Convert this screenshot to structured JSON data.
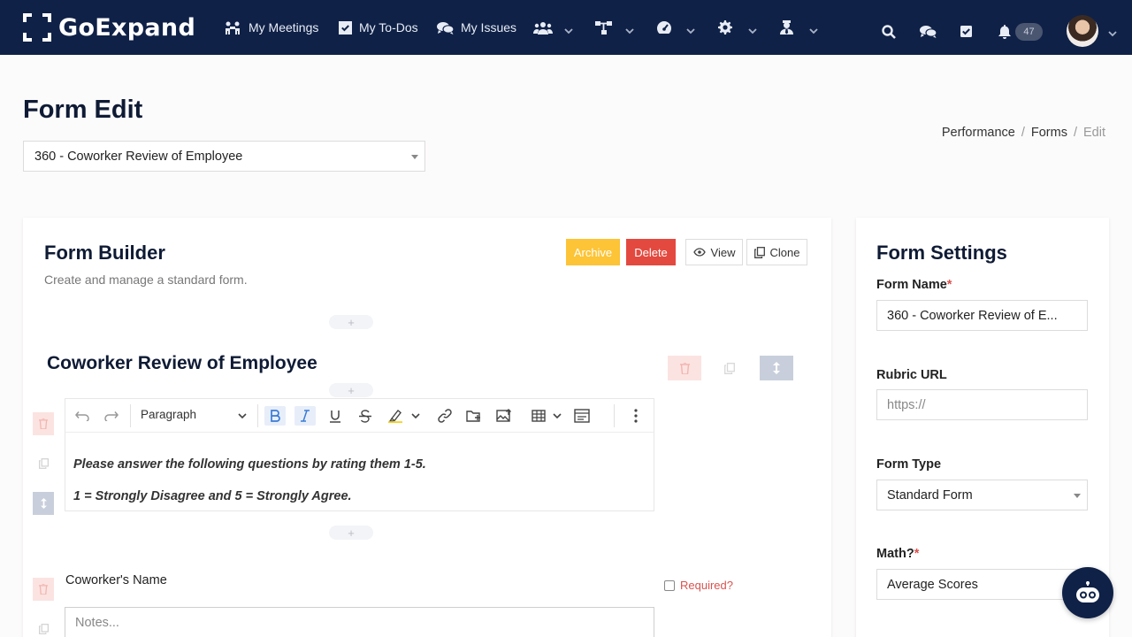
{
  "app": {
    "logo_text": "GoExpand",
    "notifications_count": "47"
  },
  "nav": {
    "my_meetings": "My Meetings",
    "my_todos": "My To-Dos",
    "my_issues": "My Issues"
  },
  "page": {
    "title": "Form Edit",
    "selected_form": "360 - Coworker Review of Employee",
    "breadcrumb": [
      "Performance",
      "Forms",
      "Edit"
    ],
    "breadcrumb_sep": "/"
  },
  "builder": {
    "title": "Form Builder",
    "subtitle": "Create and manage a standard form.",
    "archive_label": "Archive",
    "delete_label": "Delete",
    "view_label": "View",
    "clone_label": "Clone",
    "plus": "+",
    "section_title": "Coworker Review of Employee",
    "editor": {
      "block_type": "Paragraph",
      "line1": "Please answer the following questions by rating them 1-5.",
      "line2": "1 = Strongly Disagree and 5 = Strongly Agree."
    },
    "question_label": "Coworker's Name",
    "required_label": "Required?",
    "notes_placeholder": "Notes..."
  },
  "settings": {
    "title": "Form Settings",
    "form_name_label": "Form Name",
    "form_name_value": "360 - Coworker Review of E...",
    "rubric_url_label": "Rubric URL",
    "rubric_url_placeholder": "https://",
    "form_type_label": "Form Type",
    "form_type_value": "Standard Form",
    "math_label": "Math?",
    "math_value": "Average Scores",
    "required_star": "*"
  },
  "colors": {
    "navbar": "#0f2147",
    "archive": "#fcc436",
    "delete": "#e3493f",
    "required": "#d9534f"
  }
}
